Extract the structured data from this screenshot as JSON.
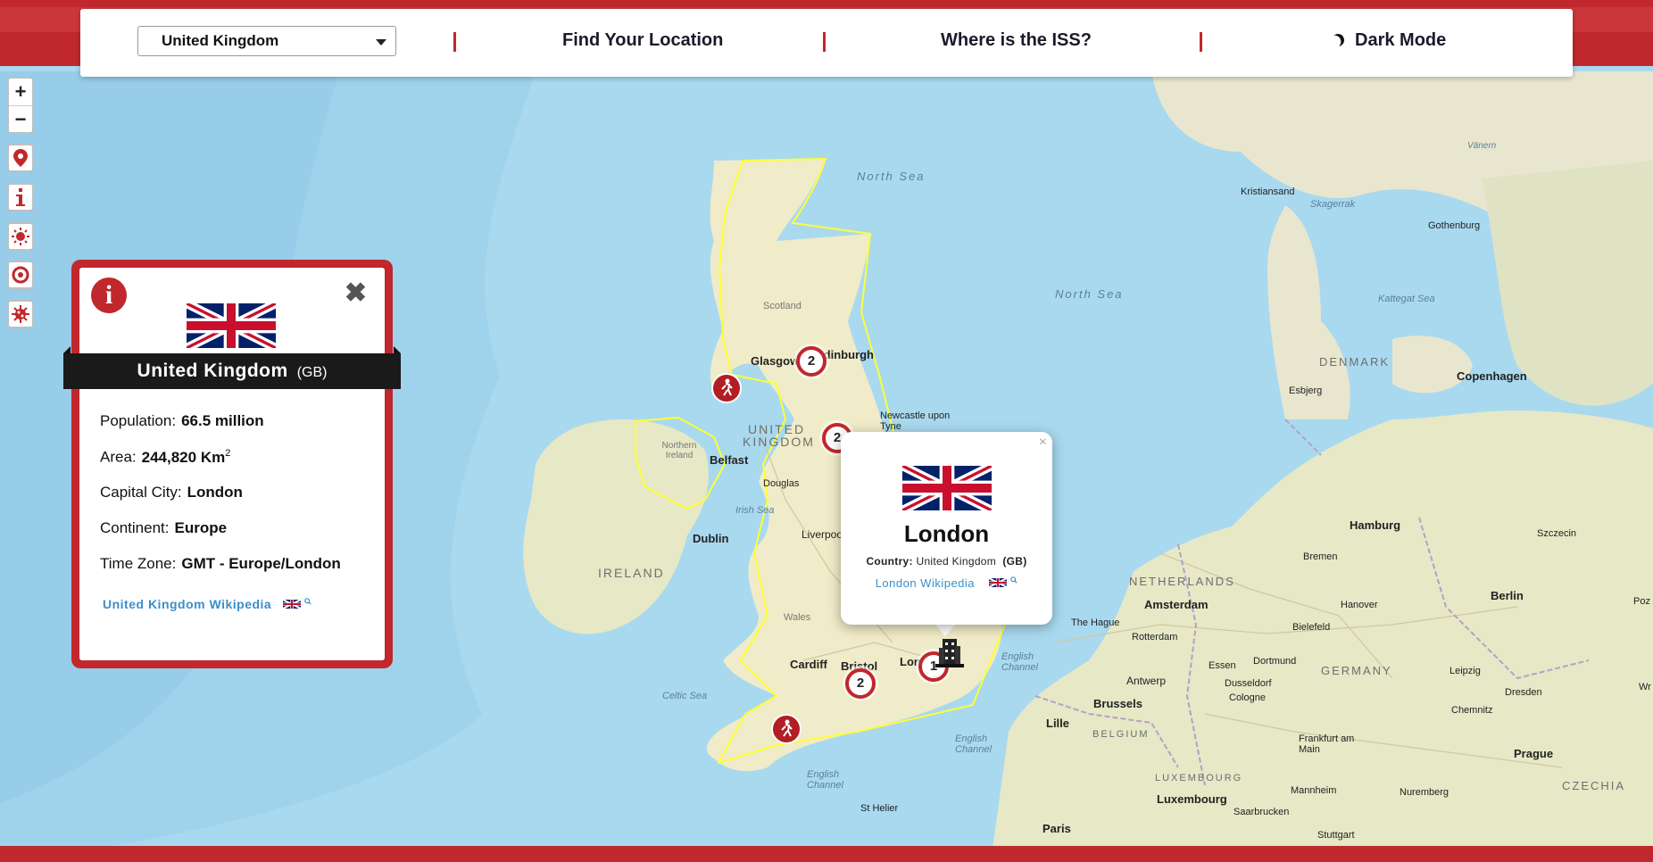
{
  "colors": {
    "accent": "#c0282d",
    "link": "#3a8ec9",
    "ribbon": "#1a1a1a",
    "boundary": "#ffff33"
  },
  "navbar": {
    "selected_country": "United Kingdom",
    "find_location": "Find Your Location",
    "iss": "Where is the ISS?",
    "dark_mode": "Dark Mode"
  },
  "map_controls": {
    "zoom_in": "+",
    "zoom_out": "−",
    "buttons": [
      "location-pin-icon",
      "info-icon",
      "sun-weather-icon",
      "covid-icon",
      "virus-icon"
    ]
  },
  "country_panel": {
    "info_icon": "i",
    "close": "✖",
    "name": "United Kingdom",
    "code": "(GB)",
    "population_label": "Population:",
    "population": "66.5 million",
    "area_label": "Area:",
    "area": "244,820 Km",
    "area_sup": "2",
    "capital_label": "Capital City:",
    "capital": "London",
    "continent_label": "Continent:",
    "continent": "Europe",
    "timezone_label": "Time Zone:",
    "timezone": "GMT - Europe/London",
    "wiki_link": "United Kingdom Wikipedia"
  },
  "city_popup": {
    "close": "×",
    "city": "London",
    "country_label": "Country:",
    "country": "United Kingdom",
    "code": "(GB)",
    "wiki_link": "London Wikipedia"
  },
  "markers": {
    "clusters": [
      "2",
      "2",
      "2",
      "1"
    ]
  },
  "map_labels": {
    "north_sea_1": "North Sea",
    "north_sea_2": "North Sea",
    "scotland": "Scotland",
    "glasgow": "Glasgow",
    "edinburgh": "Edinburgh",
    "newcastle": "Newcastle upon Tyne",
    "uk_1": "UNITED",
    "uk_2": "KINGDOM",
    "northern_ireland": "Northern Ireland",
    "belfast": "Belfast",
    "douglas": "Douglas",
    "irish_sea": "Irish Sea",
    "dublin": "Dublin",
    "ireland": "IRELAND",
    "liverpool": "Liverpool",
    "wales": "Wales",
    "cardiff": "Cardiff",
    "bristol": "Bristol",
    "london": "London",
    "celtic_sea": "Celtic Sea",
    "english_channel_1": "English Channel",
    "english_channel_2": "English Channel",
    "english_channel_3": "English Channel",
    "st_helier": "St Helier",
    "paris": "Paris",
    "lille": "Lille",
    "brussels": "Brussels",
    "belgium": "BELGIUM",
    "antwerp": "Antwerp",
    "the_hague": "The Hague",
    "rotterdam": "Rotterdam",
    "amsterdam": "Amsterdam",
    "netherlands": "NETHERLANDS",
    "luxembourg_c": "LUXEMBOURG",
    "luxembourg": "Luxembourg",
    "saarbrucken": "Saarbrucken",
    "stuttgart": "Stuttgart",
    "mannheim": "Mannheim",
    "frankfurt": "Frankfurt am Main",
    "cologne": "Cologne",
    "dusseldorf": "Dusseldorf",
    "essen": "Essen",
    "dortmund": "Dortmund",
    "bielefeld": "Bielefeld",
    "germany": "GERMANY",
    "hanover": "Hanover",
    "bremen": "Bremen",
    "hamburg": "Hamburg",
    "berlin": "Berlin",
    "leipzig": "Leipzig",
    "dresden": "Dresden",
    "chemnitz": "Chemnitz",
    "nuremberg": "Nuremberg",
    "prague": "Prague",
    "czechia": "CZECHIA",
    "szczecin": "Szczecin",
    "denmark": "DENMARK",
    "esbjerg": "Esbjerg",
    "copenhagen": "Copenhagen",
    "kattegat": "Kattegat Sea",
    "skagerrak": "Skagerrak",
    "kristiansand": "Kristiansand",
    "gothenburg": "Gothenburg",
    "vanern": "Vänern",
    "poz": "Poz",
    "wr": "Wr"
  }
}
